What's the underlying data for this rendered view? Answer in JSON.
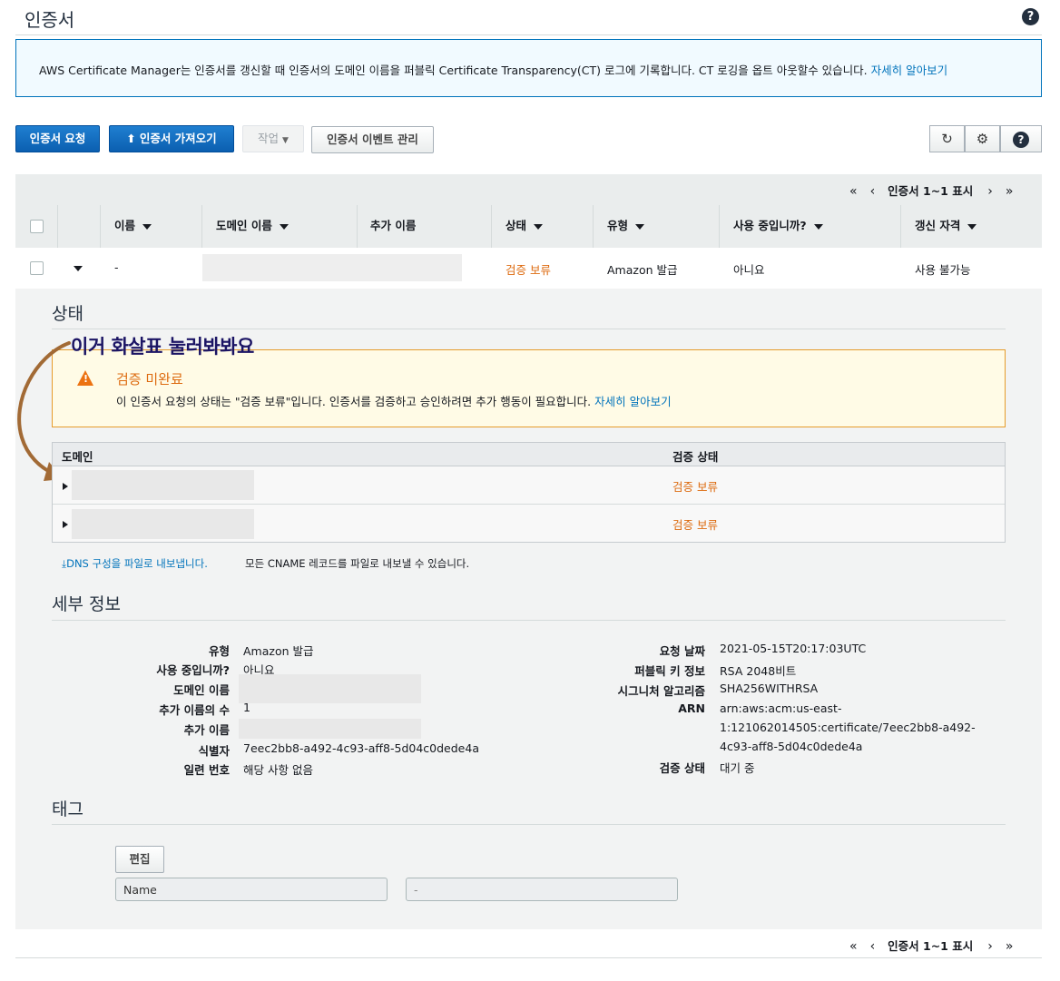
{
  "page": {
    "title": "인증서",
    "help_icon": "?"
  },
  "info_banner": {
    "text": "AWS Certificate Manager는 인증서를 갱신할 때 인증서의 도메인 이름을 퍼블릭 Certificate Transparency(CT) 로그에 기록합니다. CT 로깅을 옵트 아웃할수 있습니다.",
    "link": "자세히 알아보기"
  },
  "toolbar": {
    "request_label": "인증서 요청",
    "import_label": "인증서 가져오기",
    "actions_label": "작업",
    "events_label": "인증서 이벤트 관리",
    "refresh_icon": "↻",
    "settings_icon": "⚙",
    "help_icon": "?"
  },
  "pagination": {
    "first": "«",
    "prev": "‹",
    "text": "인증서 1~1 표시",
    "next": "›",
    "last": "»"
  },
  "table": {
    "columns": [
      "이름",
      "도메인 이름",
      "추가 이름",
      "상태",
      "유형",
      "사용 중입니까?",
      "갱신 자격"
    ],
    "row": {
      "name": "-",
      "status": "검증 보류",
      "type": "Amazon 발급",
      "in_use": "아니요",
      "renewal": "사용 불가능"
    }
  },
  "status_section": {
    "title": "상태",
    "annotation": "이거 화살표 눌러봐봐요",
    "warning_title": "검증 미완료",
    "warning_body": "이 인증서 요청의 상태는 \"검증 보류\"입니다. 인증서를 검증하고 승인하려면 추가 행동이 필요합니다.",
    "warning_link": "자세히 알아보기",
    "domain_col": "도메인",
    "validation_col": "검증 상태",
    "domain_rows": [
      {
        "status": "검증 보류"
      },
      {
        "status": "검증 보류"
      }
    ],
    "export_link": "DNS 구성을 파일로 내보냅니다.",
    "export_note": "모든 CNAME 레코드를 파일로 내보낼 수 있습니다."
  },
  "details": {
    "title": "세부 정보",
    "left": {
      "type_label": "유형",
      "type_value": "Amazon 발급",
      "in_use_label": "사용 중입니까?",
      "in_use_value": "아니요",
      "domain_label": "도메인 이름",
      "alt_count_label": "추가 이름의 수",
      "alt_count_value": "1",
      "alt_names_label": "추가 이름",
      "identifier_label": "식별자",
      "identifier_value": "7eec2bb8-a492-4c93-aff8-5d04c0dede4a",
      "serial_label": "일련 번호",
      "serial_value": "해당 사항 없음"
    },
    "right": {
      "requested_label": "요청 날짜",
      "requested_value": "2021-05-15T20:17:03UTC",
      "pubkey_label": "퍼블릭 키 정보",
      "pubkey_value": "RSA 2048비트",
      "sigalg_label": "시그니처 알고리즘",
      "sigalg_value": "SHA256WITHRSA",
      "arn_label": "ARN",
      "arn_line1": "arn:aws:acm:us-east-",
      "arn_line2": "1:121062014505:certificate/7eec2bb8-a492-",
      "arn_line3": "4c93-aff8-5d04c0dede4a",
      "validation_label": "검증 상태",
      "validation_value": "대기 중"
    }
  },
  "tags": {
    "title": "태그",
    "edit_label": "편집",
    "key_value": "Name",
    "val_value": "-"
  },
  "colors": {
    "primary": "#0a66c2",
    "pending": "#dd6b10",
    "link": "#0073bb",
    "annotation": "#1b1464",
    "arrow": "#a26a35"
  }
}
